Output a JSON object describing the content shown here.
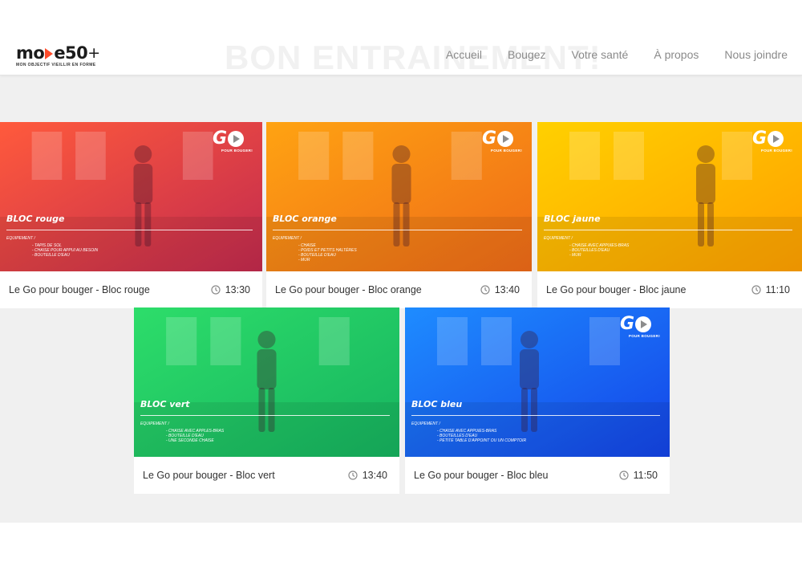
{
  "brand": {
    "logo_word_start": "mo",
    "logo_word_end": "e50",
    "logo_plus": "+",
    "logo_tagline": "MON OBJECTIF VIEILLIR EN FORME"
  },
  "header": {
    "ghost_title": "BON ENTRAINEMENT!",
    "nav": [
      "Accueil",
      "Bougez",
      "Votre santé",
      "À propos",
      "Nous joindre"
    ]
  },
  "videos": [
    {
      "bloc": "BLOC rouge",
      "equipment_label": "EQUIPEMENT /",
      "equipment": [
        "- TAPIS DE SOL",
        "- CHAISE POUR APPUI AU BESOIN",
        "- BOUTEILLE D'EAU"
      ],
      "title": "Le Go pour bouger - Bloc rouge",
      "duration": "13:30",
      "color_a": "#ff5a3c",
      "color_b": "#c22a4e"
    },
    {
      "bloc": "BLOC orange",
      "equipment_label": "EQUIPEMENT /",
      "equipment": [
        "- CHAISE",
        "- POIDS ET PETITS HALTÈRES",
        "- BOUTEILLE D'EAU",
        "- MUR"
      ],
      "title": "Le Go pour bouger - Bloc orange",
      "duration": "13:40",
      "color_a": "#ffa312",
      "color_b": "#ee6a18"
    },
    {
      "bloc": "BLOC jaune",
      "equipment_label": "EQUIPEMENT /",
      "equipment": [
        "- CHAISE AVEC APPUIES-BRAS",
        "- BOUTEILLES D'EAU",
        "- MUR"
      ],
      "title": "Le Go pour bouger - Bloc jaune",
      "duration": "11:10",
      "color_a": "#ffd000",
      "color_b": "#ffa000"
    },
    {
      "bloc": "BLOC vert",
      "equipment_label": "EQUIPEMENT /",
      "equipment": [
        "- CHAISE AVEC APPLES-BRAS",
        "- BOUTEILLE D'EAU",
        "- UNE SECONDE CHAISE"
      ],
      "title": "Le Go pour bouger - Bloc vert",
      "duration": "13:40",
      "color_a": "#2ddd6a",
      "color_b": "#16b35f"
    },
    {
      "bloc": "BLOC bleu",
      "equipment_label": "EQUIPEMENT /",
      "equipment": [
        "- CHAISE AVEC APPUIES-BRAS",
        "- BOUTEILLES D'EAU",
        "- PETITE TABLE D'APPOINT OU UN COMPTOIR"
      ],
      "title": "Le Go pour bouger - Bloc bleu",
      "duration": "11:50",
      "color_a": "#1e8cff",
      "color_b": "#1444e8"
    }
  ],
  "go_logo": {
    "letters": "GO",
    "tagline": "POUR BOUGER!"
  }
}
